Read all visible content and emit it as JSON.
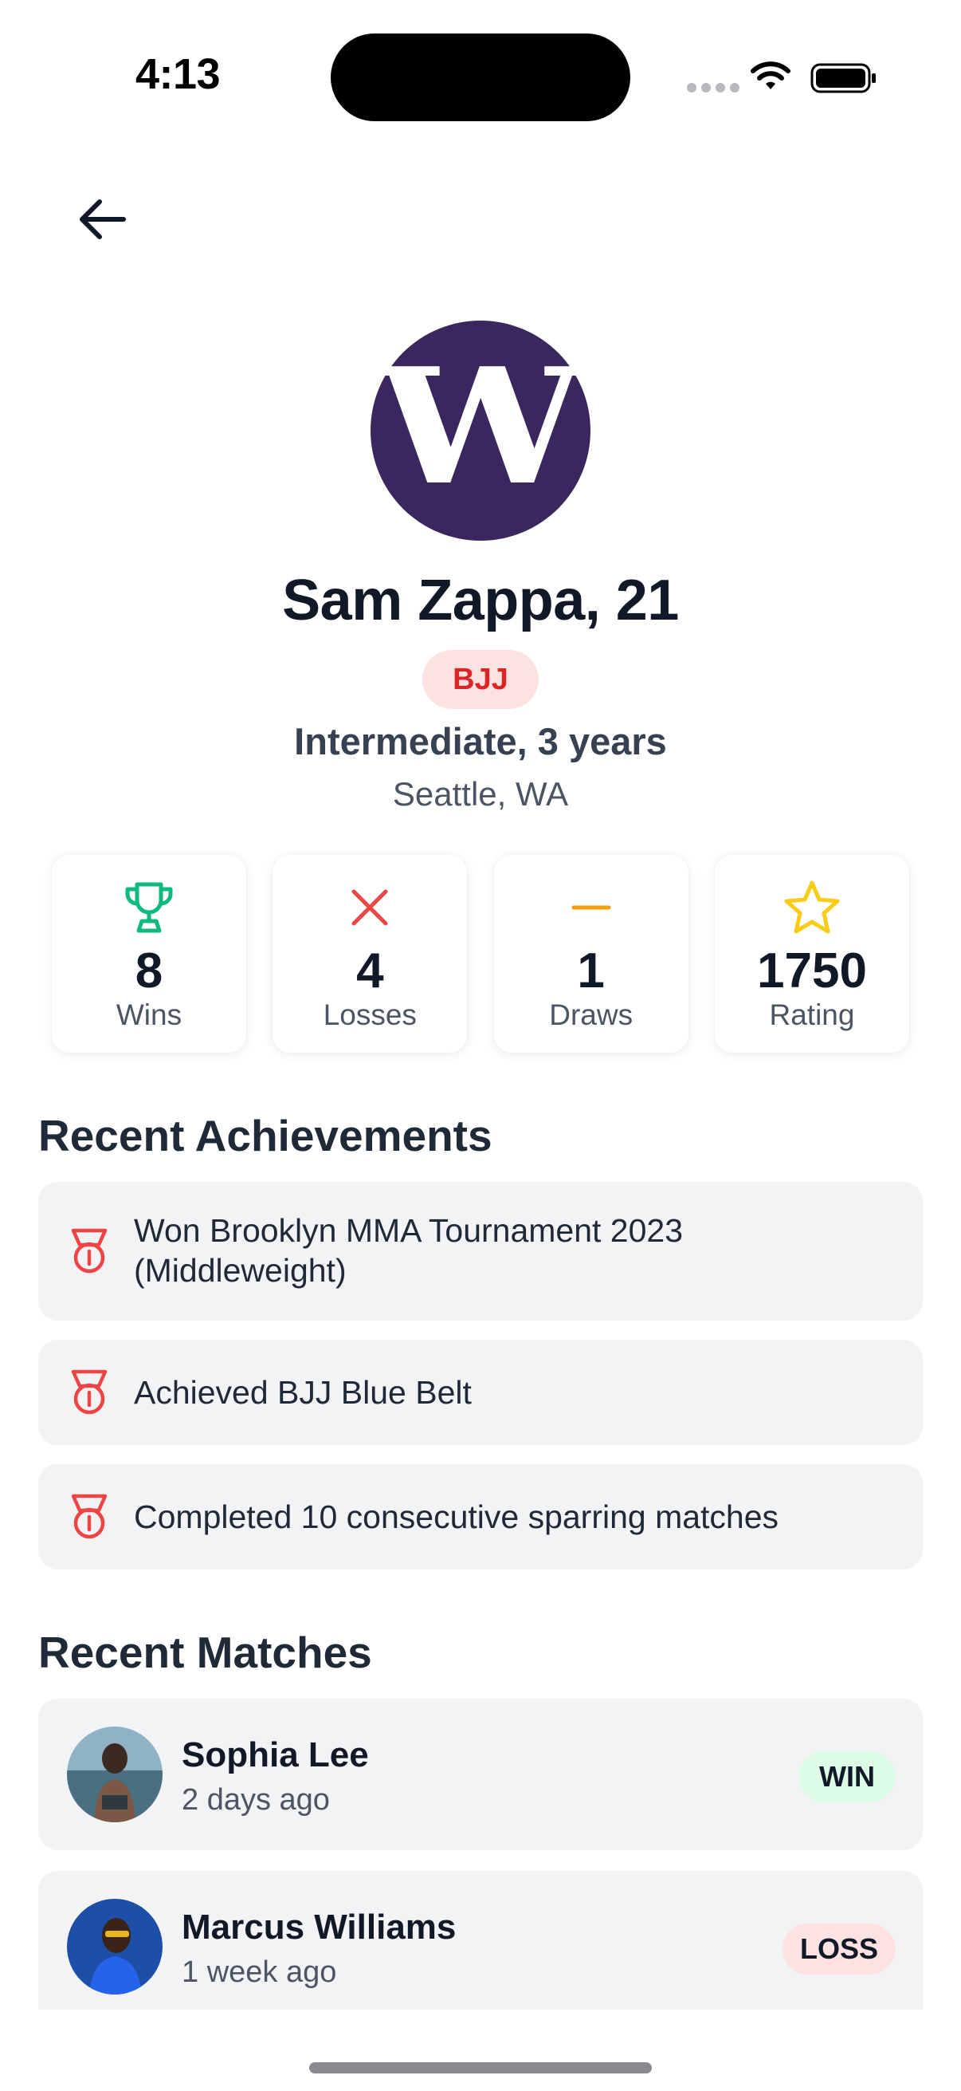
{
  "status_bar": {
    "time": "4:13"
  },
  "profile": {
    "avatar_letter": "W",
    "name": "Sam Zappa, 21",
    "sport": "BJJ",
    "experience": "Intermediate, 3 years",
    "location": "Seattle, WA"
  },
  "stats": [
    {
      "icon": "trophy-icon",
      "value": "8",
      "label": "Wins",
      "color": "#10b981"
    },
    {
      "icon": "x-icon",
      "value": "4",
      "label": "Losses",
      "color": "#ef4444"
    },
    {
      "icon": "minus-icon",
      "value": "1",
      "label": "Draws",
      "color": "#f59e0b"
    },
    {
      "icon": "star-icon",
      "value": "1750",
      "label": "Rating",
      "color": "#facc15"
    }
  ],
  "achievements": {
    "title": "Recent Achievements",
    "icon": "medal-icon",
    "icon_color": "#ef4444",
    "items": [
      "Won Brooklyn MMA Tournament 2023 (Middleweight)",
      "Achieved BJJ Blue Belt",
      "Completed 10 consecutive sparring matches"
    ]
  },
  "matches": {
    "title": "Recent Matches",
    "items": [
      {
        "name": "Sophia Lee",
        "time": "2 days ago",
        "result": "WIN",
        "badge_color": "#dcfce7"
      },
      {
        "name": "Marcus Williams",
        "time": "1 week ago",
        "result": "LOSS",
        "badge_color": "#fee2e2"
      }
    ]
  },
  "colors": {
    "avatar_bg": "#3a2760",
    "badge_bg": "#fde2e2",
    "badge_text": "#dc2626",
    "card_bg": "#f2f3f5"
  }
}
